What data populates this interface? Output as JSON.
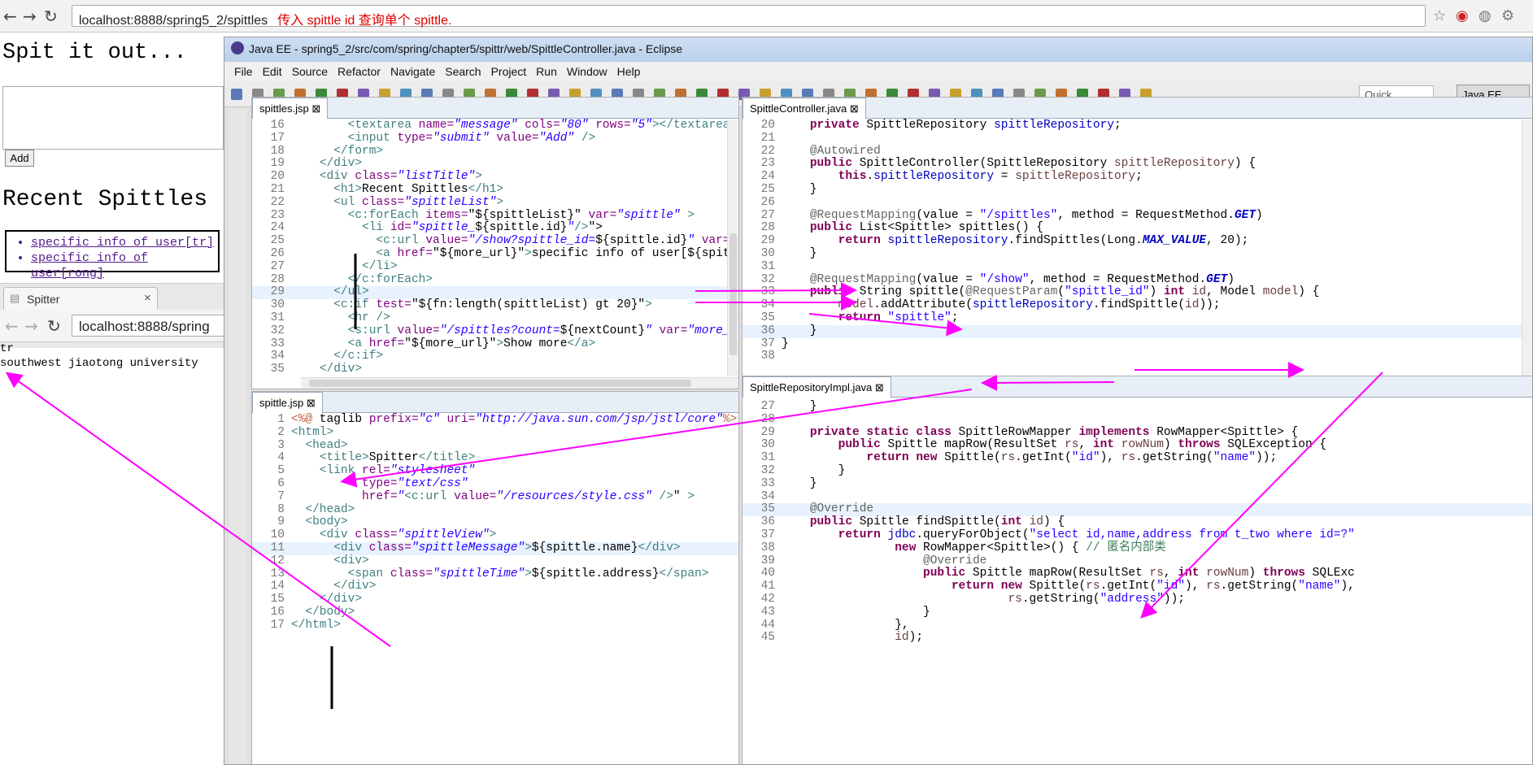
{
  "browser": {
    "url": "localhost:8888/spring5_2/spittles",
    "url_note": "传入 spittle id 查询单个 spittle."
  },
  "left_page": {
    "heading": "Spit it out...",
    "add_button": "Add",
    "recent_heading": "Recent Spittles",
    "links": [
      "specific info of user[tr]",
      "specific info of user[rong]"
    ]
  },
  "second_browser": {
    "tab_title": "Spitter",
    "url": "localhost:8888/spring",
    "result_lines": [
      "tr",
      "southwest jiaotong university"
    ]
  },
  "eclipse": {
    "title": "Java EE - spring5_2/src/com/spring/chapter5/spittr/web/SpittleController.java - Eclipse",
    "menu": [
      "File",
      "Edit",
      "Source",
      "Refactor",
      "Navigate",
      "Search",
      "Project",
      "Run",
      "Window",
      "Help"
    ],
    "quick_access": "Quick Access",
    "perspective": "Java EE",
    "editors": {
      "spittles_jsp": {
        "tab": "spittles.jsp"
      },
      "spittle_jsp": {
        "tab": "spittle.jsp"
      },
      "controller": {
        "tab": "SpittleController.java"
      },
      "repo": {
        "tab": "SpittleRepositoryImpl.java"
      }
    }
  },
  "colors": {
    "arrow": "#ff00ff",
    "keyword": "#7f0055",
    "string": "#2a00ff"
  }
}
